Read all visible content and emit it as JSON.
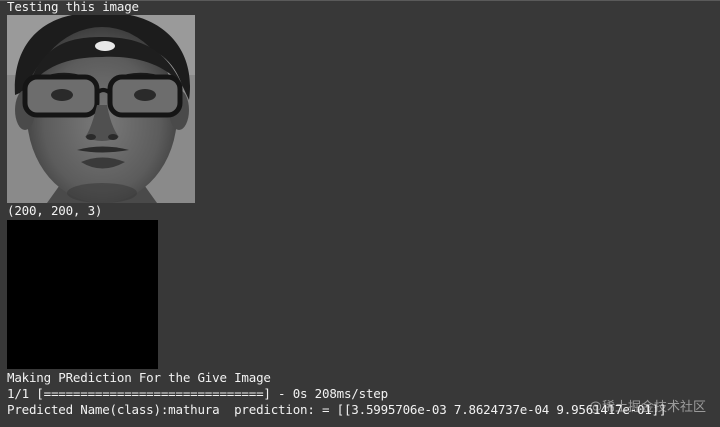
{
  "output": {
    "testing_label": "Testing this image",
    "shape_text": "(200, 200, 3)",
    "making_prediction": "Making PRediction For the Give Image",
    "progress_line": "1/1 [==============================] - 0s 208ms/step",
    "predicted_line": "Predicted Name(class):mathura  prediction: = [[3.5995706e-03 7.8624737e-04 9.9561417e-01]]"
  },
  "watermark": "@稀土掘金技术社区",
  "colors": {
    "background": "#383838",
    "text": "#f2f2f2"
  }
}
